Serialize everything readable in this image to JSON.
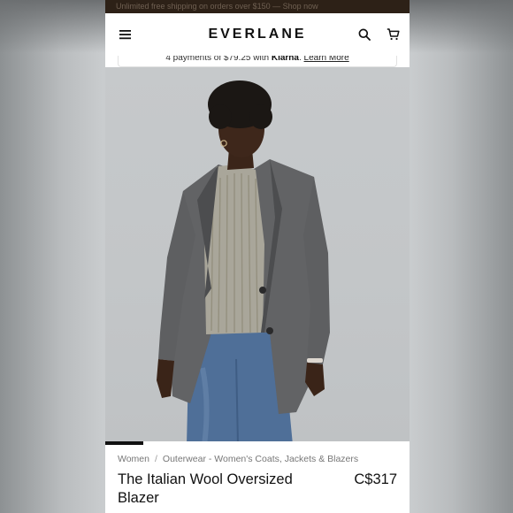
{
  "promo": {
    "text": "Unlimited free shipping on orders over $150 — Shop now"
  },
  "header": {
    "logo": "EVERLANE",
    "menu_icon": "hamburger-menu-icon",
    "search_icon": "search-icon",
    "cart_icon": "cart-icon"
  },
  "klarna": {
    "prefix": "4 payments of $79.25 with ",
    "brand": "Klarna",
    "separator": ". ",
    "link": "Learn More"
  },
  "gallery": {
    "progress": 0.125,
    "image_alt": "Model wearing a grey wool oversized blazer over a ribbed sweater and blue jeans"
  },
  "breadcrumb": {
    "level1": "Women",
    "separator": "/",
    "level2": "Outerwear - Women's Coats, Jackets & Blazers"
  },
  "product": {
    "title": "The Italian Wool Oversized Blazer",
    "price": "C$317"
  },
  "colors": {
    "promo_bg": "#2d2117",
    "text": "#111111",
    "muted": "#777777"
  }
}
